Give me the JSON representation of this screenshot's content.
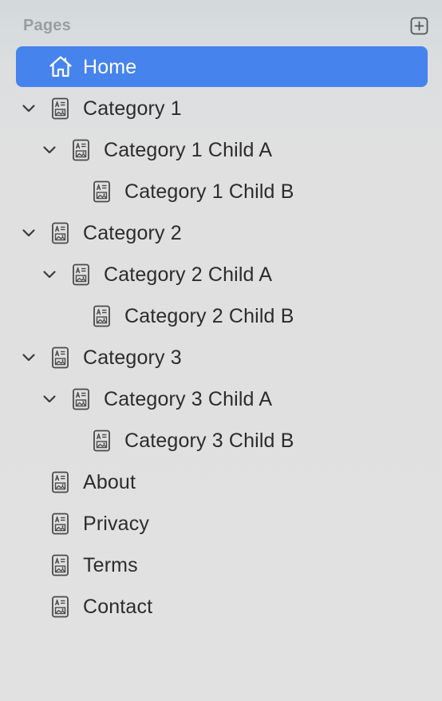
{
  "sidebar": {
    "title": "Pages",
    "add_icon": "plus-square-icon",
    "accent_color": "#4683ec",
    "items": [
      {
        "label": "Home",
        "icon": "house-icon",
        "level": 0,
        "selected": true,
        "expandable": false
      },
      {
        "label": "Category 1",
        "icon": "page-icon",
        "level": 0,
        "expanded": true,
        "expandable": true
      },
      {
        "label": "Category 1 Child A",
        "icon": "page-icon",
        "level": 1,
        "expanded": true,
        "expandable": true
      },
      {
        "label": "Category 1 Child B",
        "icon": "page-icon",
        "level": 2,
        "expandable": false
      },
      {
        "label": "Category 2",
        "icon": "page-icon",
        "level": 0,
        "expanded": true,
        "expandable": true
      },
      {
        "label": "Category 2 Child A",
        "icon": "page-icon",
        "level": 1,
        "expanded": true,
        "expandable": true
      },
      {
        "label": "Category 2 Child B",
        "icon": "page-icon",
        "level": 2,
        "expandable": false
      },
      {
        "label": "Category 3",
        "icon": "page-icon",
        "level": 0,
        "expanded": true,
        "expandable": true
      },
      {
        "label": "Category 3 Child A",
        "icon": "page-icon",
        "level": 1,
        "expanded": true,
        "expandable": true
      },
      {
        "label": "Category 3 Child B",
        "icon": "page-icon",
        "level": 2,
        "expandable": false
      },
      {
        "label": "About",
        "icon": "page-icon",
        "level": 0,
        "expandable": false
      },
      {
        "label": "Privacy",
        "icon": "page-icon",
        "level": 0,
        "expandable": false
      },
      {
        "label": "Terms",
        "icon": "page-icon",
        "level": 0,
        "expandable": false
      },
      {
        "label": "Contact",
        "icon": "page-icon",
        "level": 0,
        "expandable": false
      }
    ]
  }
}
